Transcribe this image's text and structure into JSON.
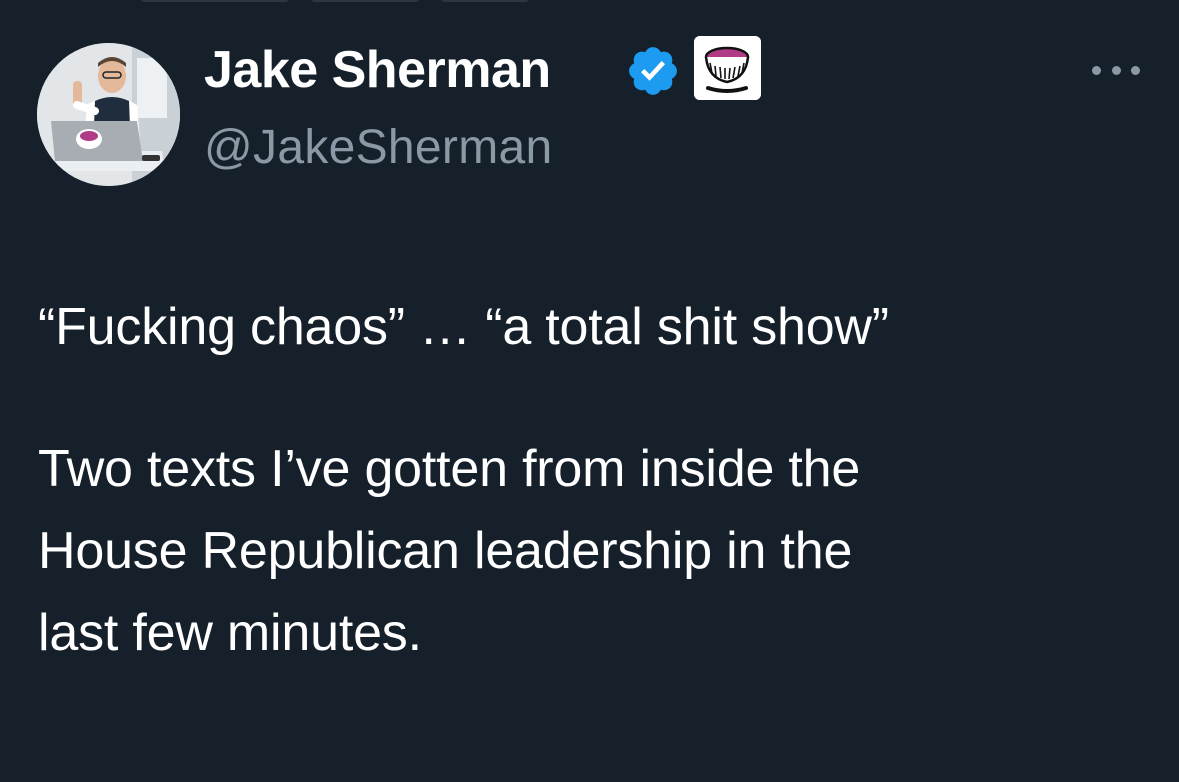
{
  "tweet": {
    "author": {
      "name": "Jake Sherman",
      "handle": "@JakeSherman"
    },
    "badges": {
      "verified_icon": "verified-check-icon",
      "verified_color": "#1d9bf0",
      "affiliate_icon": "punchbowl-affiliate-icon"
    },
    "more_icon": "more-horizontal-icon",
    "paragraphs": [
      [
        "“Fucking chaos” … “a total shit show”"
      ],
      [
        "Two texts I’ve gotten from inside the",
        "House Republican leadership in the",
        "last few minutes."
      ]
    ]
  },
  "colors": {
    "background": "#15202b",
    "text": "#ffffff",
    "secondary_text": "#8b98a5",
    "verified": "#1d9bf0"
  }
}
